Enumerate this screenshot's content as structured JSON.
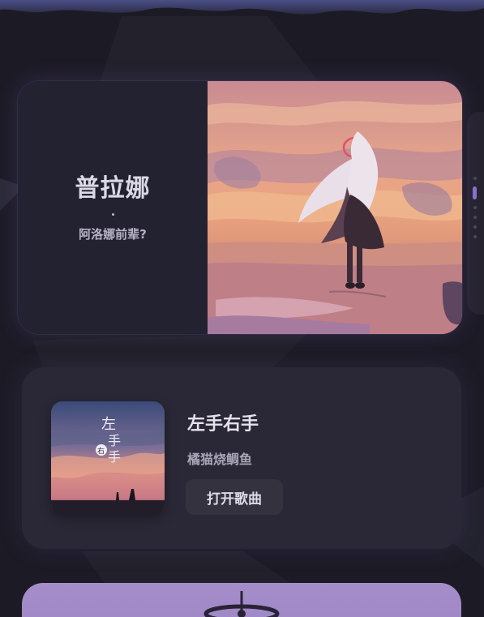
{
  "hero": {
    "title": "普拉娜",
    "subtitle": "阿洛娜前辈?",
    "image_icon": "anime-girl-sunset-illustration"
  },
  "pager": {
    "count": 6,
    "active_index": 1
  },
  "song": {
    "title": "左手右手",
    "artist": "橘猫烧鲷鱼",
    "open_label": "打开歌曲",
    "cover_icon": "album-cover-sunset-art"
  },
  "bottom": {
    "icon": "orbit-logo-icon"
  },
  "colors": {
    "background": "#1c1b25",
    "accent": "#8b6fd0",
    "card": "#2a2836",
    "bottom_card": "#a58dca"
  }
}
